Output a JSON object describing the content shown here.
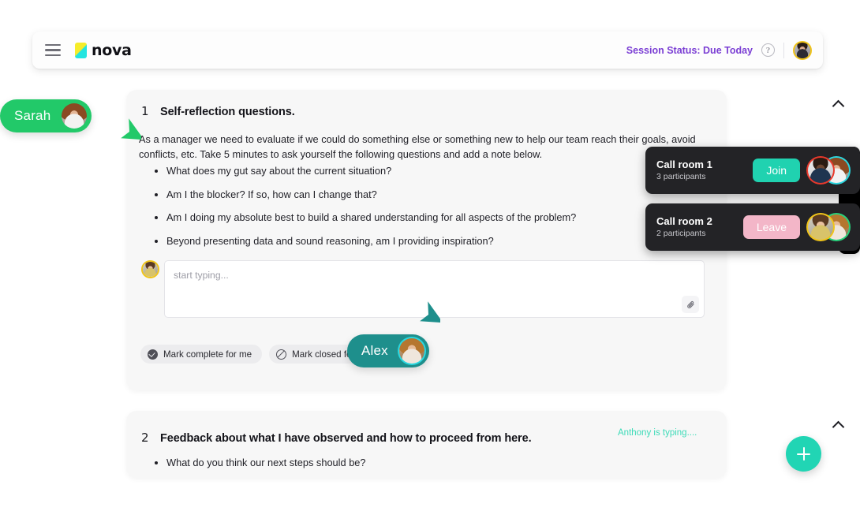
{
  "header": {
    "menu_icon": "hamburger-icon",
    "brand": "nova",
    "session_status": "Session Status: Due Today",
    "help_icon": "?",
    "user_avatar": "avatar"
  },
  "sections": [
    {
      "number": "1",
      "title": "Self-reflection questions.",
      "collapse_icon": "chevron-up-icon",
      "body": "As a manager we need to evaluate if we could do something else or something new to help our team reach their goals, avoid conflicts, etc. Take 5 minutes to ask yourself the following questions and add a note below.",
      "questions": [
        "What does my gut say about the current situation?",
        "Am I the blocker? If so, how can I change that?",
        "Am I doing my absolute best to build a shared understanding for all aspects of the problem?",
        "Beyond presenting data and sound reasoning, am I providing inspiration?"
      ],
      "note": {
        "placeholder": "start typing...",
        "value": "",
        "attach_icon": "paperclip-icon"
      },
      "actions": [
        {
          "label": "Mark complete for me",
          "icon": "check-circle-icon"
        },
        {
          "label": "Mark closed for all",
          "icon": "slash-circle-icon"
        }
      ]
    },
    {
      "number": "2",
      "title": "Feedback about what I have observed and how to proceed from here.",
      "collapse_icon": "chevron-up-icon",
      "typing_indicator": "Anthony is typing....",
      "questions": [
        "What do you think our next steps should be?"
      ]
    }
  ],
  "presence": [
    {
      "name": "Sarah",
      "color": "#22c969"
    },
    {
      "name": "Alex",
      "color": "#1e8f8c"
    }
  ],
  "call_rooms": [
    {
      "name": "Call room 1",
      "participants": "3 participants",
      "action_label": "Join",
      "action_color": "#20d2b0"
    },
    {
      "name": "Call room 2",
      "participants": "2 participants",
      "action_label": "Leave",
      "action_color": "#f3b6c8"
    }
  ],
  "fab": {
    "icon": "plus-icon"
  },
  "colors": {
    "accent_teal": "#21d5b4",
    "presence_green": "#22c969",
    "status_purple": "#7b3fd4",
    "typing_mint": "#3ddbb8",
    "card_bg": "#f7f7f7",
    "dark_panel": "#232326"
  }
}
